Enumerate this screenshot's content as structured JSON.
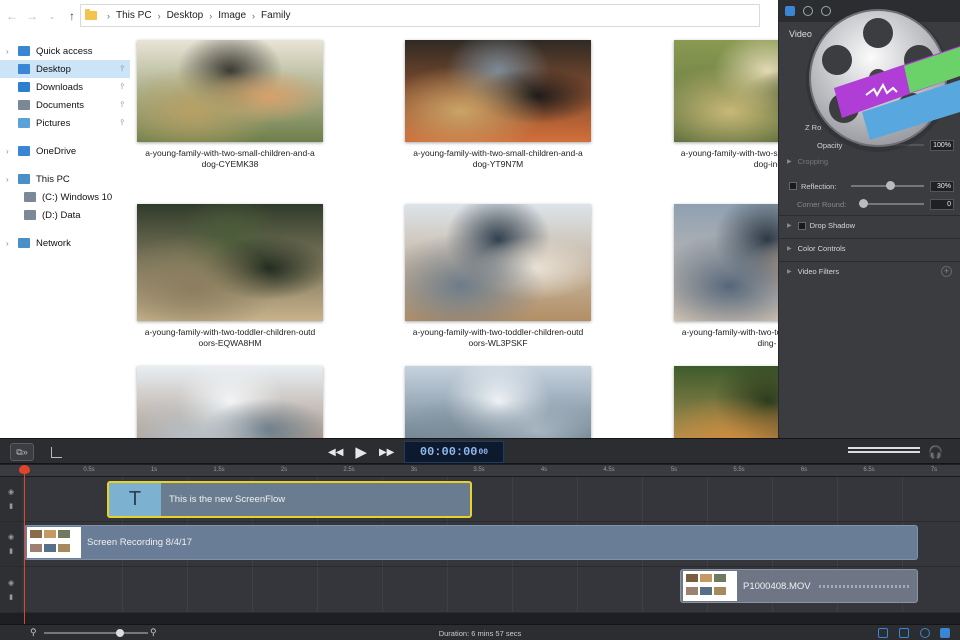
{
  "explorer": {
    "breadcrumb": [
      "This PC",
      "Desktop",
      "Image",
      "Family"
    ],
    "sidebar": [
      {
        "label": "Quick access",
        "icon": "star-icon",
        "level": 0,
        "selected": false,
        "pinned": false
      },
      {
        "label": "Desktop",
        "icon": "desktop-icon",
        "level": 1,
        "selected": true,
        "pinned": true
      },
      {
        "label": "Downloads",
        "icon": "download-icon",
        "level": 1,
        "selected": false,
        "pinned": true
      },
      {
        "label": "Documents",
        "icon": "documents-icon",
        "level": 1,
        "selected": false,
        "pinned": true
      },
      {
        "label": "Pictures",
        "icon": "pictures-icon",
        "level": 1,
        "selected": false,
        "pinned": true
      },
      {
        "label": "OneDrive",
        "icon": "cloud-icon",
        "level": 0,
        "selected": false,
        "pinned": false
      },
      {
        "label": "This PC",
        "icon": "computer-icon",
        "level": 0,
        "selected": false,
        "pinned": false
      },
      {
        "label": "(C:) Windows 10",
        "icon": "drive-icon",
        "level": 2,
        "selected": false,
        "pinned": false
      },
      {
        "label": "(D:) Data",
        "icon": "drive-icon",
        "level": 2,
        "selected": false,
        "pinned": false
      },
      {
        "label": "Network",
        "icon": "network-icon",
        "level": 0,
        "selected": false,
        "pinned": false
      }
    ],
    "files": [
      {
        "line1": "a-young-family-with-two-small-children-and-a",
        "line2": "dog-CYEMK38"
      },
      {
        "line1": "a-young-family-with-two-small-children-and-a",
        "line2": "dog-YT9N7M"
      },
      {
        "line1": "a-young-family-with-two-small-children-and-a-",
        "line2": "dog-in-"
      },
      {
        "line1": "a-young-family-with-two-toddler-children-outd",
        "line2": "oors-EQWA8HM"
      },
      {
        "line1": "a-young-family-with-two-toddler-children-outd",
        "line2": "oors-WL3PSKF"
      },
      {
        "line1": "a-young-family-with-two-toddler-children-outd",
        "line2": "ding-"
      },
      {
        "line1": "",
        "line2": ""
      },
      {
        "line1": "",
        "line2": ""
      },
      {
        "line1": "",
        "line2": ""
      }
    ]
  },
  "inspector": {
    "tab_title": "Video",
    "rotation_label": "Z Ro",
    "opacity_label": "Opacity",
    "opacity_value": "100%",
    "cropping_label": "Cropping",
    "reflection_label": "Reflection:",
    "reflection_value": "30%",
    "corner_label": "Corner Round:",
    "corner_value": "0",
    "drop_shadow_label": "Drop Shadow",
    "color_controls_label": "Color Controls",
    "video_filters_label": "Video Filters"
  },
  "toolbar": {
    "timecode": "00:00:00",
    "timecode_frames": "00"
  },
  "timeline": {
    "ruler": [
      "0.5s",
      "1s",
      "1.5s",
      "2s",
      "2.5s",
      "3s",
      "3.5s",
      "4s",
      "4.5s",
      "5s",
      "5.5s",
      "6s",
      "6.5s",
      "7s"
    ],
    "text_clip": {
      "icon": "T",
      "label": "This is the new ScreenFlow"
    },
    "recording_clip": {
      "label": "Screen Recording 8/4/17"
    },
    "media_clip": {
      "label": "P1000408.MOV"
    },
    "duration": "Duration: 6 mins 57 secs"
  },
  "colors": {
    "accent": "#3a86d4",
    "playhead": "#e0452b",
    "text_clip_border": "#e8d22a",
    "timecode_text": "#8fb7ee"
  }
}
